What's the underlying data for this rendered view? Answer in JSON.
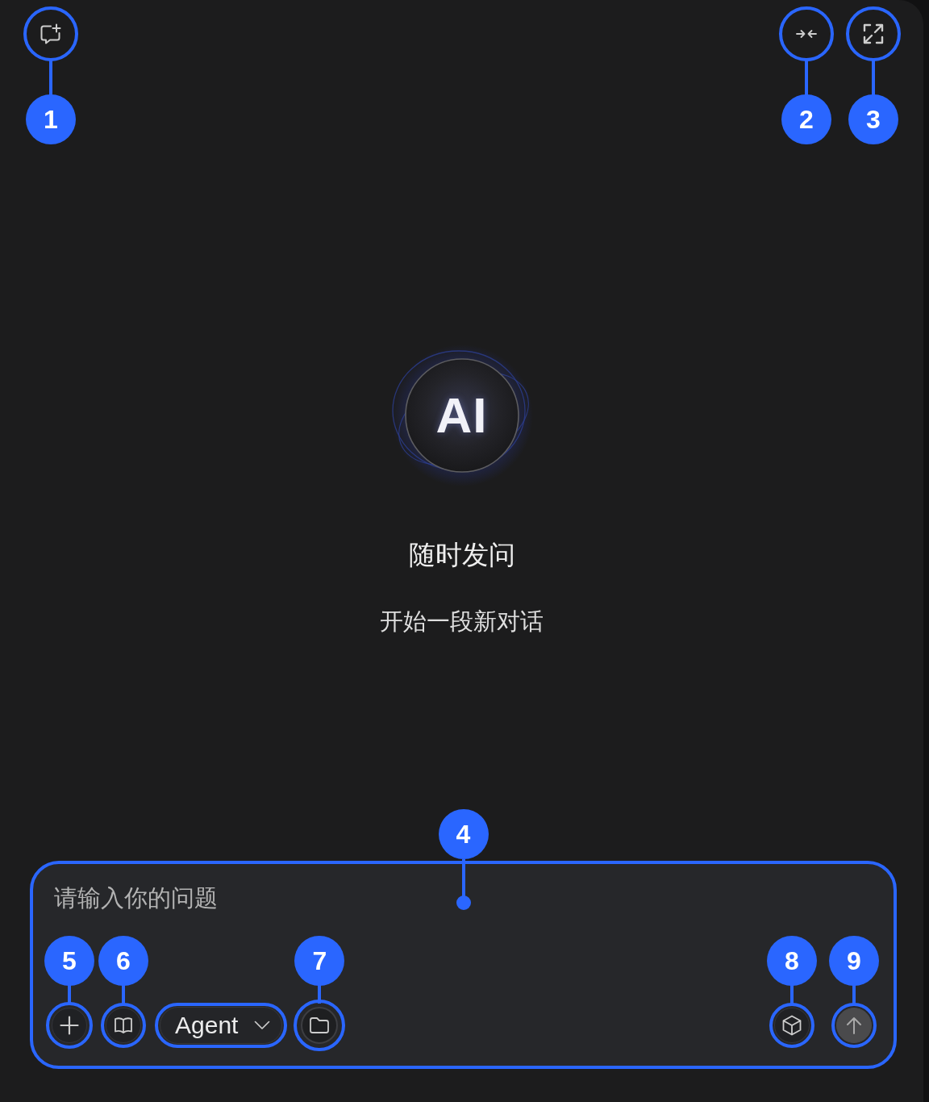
{
  "header": {
    "left_buttons": [
      {
        "kind": "new",
        "highlighted": true,
        "callout": "1"
      }
    ],
    "right_buttons": [
      {
        "kind": "collapse",
        "highlighted": true,
        "callout": "2"
      },
      {
        "kind": "expand",
        "highlighted": true,
        "callout": "3"
      }
    ]
  },
  "hero": {
    "logo": "AI",
    "title": "随时发问",
    "subtitle": "开始一段新对话"
  },
  "composer": {
    "placeholder": "请输入你的问题",
    "highlighted": true,
    "callout": "4",
    "tools": [
      {
        "kind": "attach",
        "highlighted": true,
        "callout": "5"
      },
      {
        "kind": "library",
        "highlighted": true,
        "callout": "6"
      },
      {
        "kind": "mode",
        "label": "Agent",
        "highlighted": true
      },
      {
        "kind": "files",
        "highlighted": true,
        "callout": "7"
      }
    ],
    "actions": [
      {
        "kind": "tools",
        "highlighted": true,
        "callout": "8",
        "disabled": false
      },
      {
        "kind": "send",
        "highlighted": true,
        "callout": "9",
        "disabled": true
      }
    ]
  }
}
